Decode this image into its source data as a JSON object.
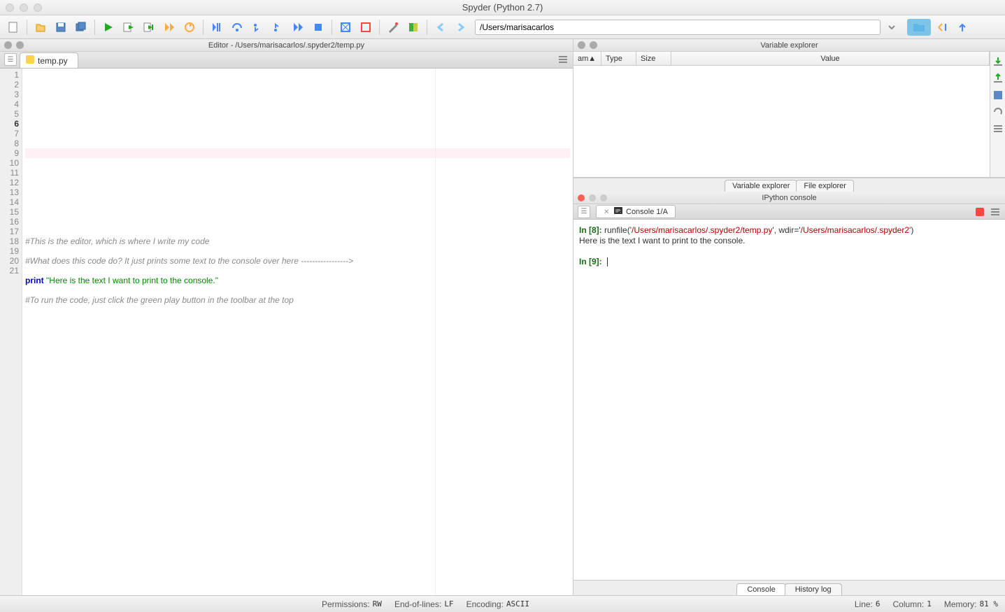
{
  "window": {
    "title": "Spyder (Python 2.7)"
  },
  "toolbar": {
    "working_dir": "/Users/marisacarlos"
  },
  "editor": {
    "pane_title": "Editor - /Users/marisacarlos/.spyder2/temp.py",
    "tab_label": "temp.py",
    "current_line": 6,
    "lines": [
      {
        "n": 1,
        "type": "blank",
        "text": ""
      },
      {
        "n": 2,
        "type": "blank",
        "text": ""
      },
      {
        "n": 3,
        "type": "blank",
        "text": ""
      },
      {
        "n": 4,
        "type": "blank",
        "text": ""
      },
      {
        "n": 5,
        "type": "blank",
        "text": ""
      },
      {
        "n": 6,
        "type": "blank",
        "text": ""
      },
      {
        "n": 7,
        "type": "blank",
        "text": ""
      },
      {
        "n": 8,
        "type": "blank",
        "text": ""
      },
      {
        "n": 9,
        "type": "blank",
        "text": ""
      },
      {
        "n": 10,
        "type": "blank",
        "text": ""
      },
      {
        "n": 11,
        "type": "blank",
        "text": ""
      },
      {
        "n": 12,
        "type": "blank",
        "text": ""
      },
      {
        "n": 13,
        "type": "blank",
        "text": ""
      },
      {
        "n": 14,
        "type": "blank",
        "text": ""
      },
      {
        "n": 15,
        "type": "comment",
        "text": "#This is the editor, which is where I write my code"
      },
      {
        "n": 16,
        "type": "blank",
        "text": ""
      },
      {
        "n": 17,
        "type": "comment",
        "text": "#What does this code do? It just prints some text to the console over here ----------------->"
      },
      {
        "n": 18,
        "type": "blank",
        "text": ""
      },
      {
        "n": 19,
        "type": "print",
        "keyword": "print",
        "string": "\"Here is the text I want to print to the console.\""
      },
      {
        "n": 20,
        "type": "blank",
        "text": ""
      },
      {
        "n": 21,
        "type": "comment",
        "text": "#To run the code, just click the green play button in the toolbar at the top"
      }
    ]
  },
  "variable_explorer": {
    "pane_title": "Variable explorer",
    "columns": {
      "name": "am",
      "type": "Type",
      "size": "Size",
      "value": "Value"
    },
    "bottom_tabs": [
      "Variable explorer",
      "File explorer"
    ]
  },
  "ipython": {
    "pane_title": "IPython console",
    "tab_label": "Console 1/A",
    "in8_prompt": "In [8]:",
    "in8_cmd_prefix": " runfile(",
    "in8_arg1": "'/Users/marisacarlos/.spyder2/temp.py'",
    "in8_sep": ", wdir=",
    "in8_arg2": "'/Users/marisacarlos/.spyder2'",
    "in8_suffix": ")",
    "out_text": "Here is the text I want to print to the console.",
    "in9_prompt": "In [9]:",
    "bottom_tabs": [
      "Console",
      "History log"
    ]
  },
  "status": {
    "permissions_label": "Permissions:",
    "permissions": "RW",
    "eol_label": "End-of-lines:",
    "eol": "LF",
    "encoding_label": "Encoding:",
    "encoding": "ASCII",
    "line_label": "Line:",
    "line": "6",
    "column_label": "Column:",
    "column": "1",
    "memory_label": "Memory:",
    "memory": "81 %"
  }
}
